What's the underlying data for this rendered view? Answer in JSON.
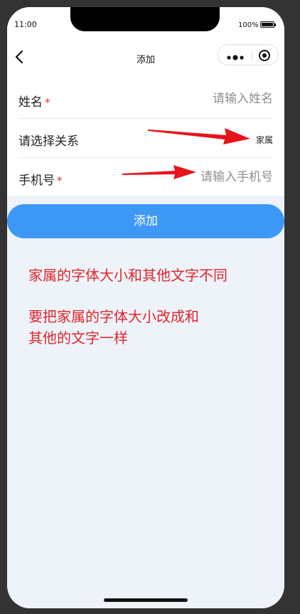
{
  "status_bar": {
    "time": "11:00",
    "battery": "100%"
  },
  "nav": {
    "title": "添加"
  },
  "form": {
    "name": {
      "label": "姓名",
      "required_mark": "*",
      "placeholder": "请输入姓名"
    },
    "relation": {
      "label": "请选择关系",
      "value": "家属"
    },
    "phone": {
      "label": "手机号",
      "required_mark": "*",
      "placeholder": "请输入手机号"
    }
  },
  "actions": {
    "add_label": "添加"
  },
  "annotations": {
    "note1": "家属的字体大小和其他文字不同",
    "note2_line1": "要把家属的字体大小改成和",
    "note2_line2": "其他的文字一样",
    "color": "#e0262a"
  },
  "colors": {
    "primary": "#3d98f5",
    "page_bg": "#eef3fa",
    "required": "#e0322f"
  }
}
